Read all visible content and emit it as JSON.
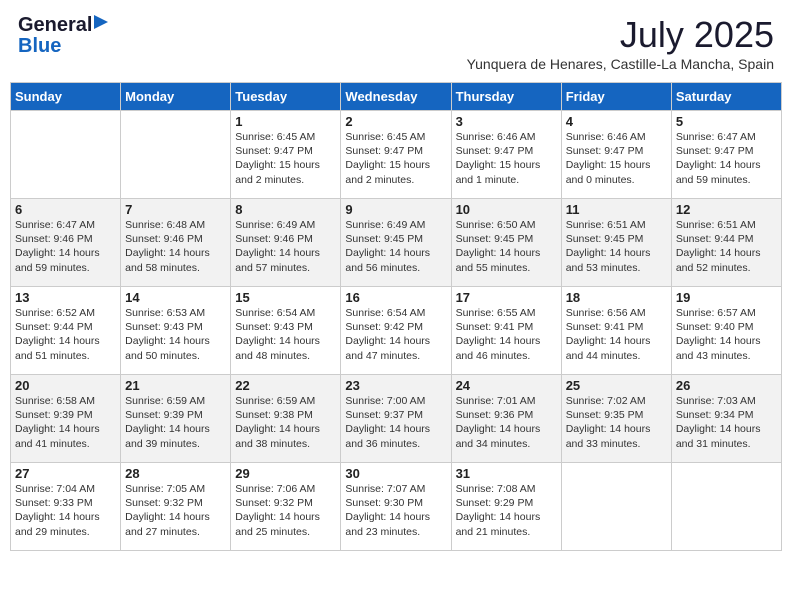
{
  "logo": {
    "general": "General",
    "blue": "Blue"
  },
  "title": {
    "month_year": "July 2025",
    "location": "Yunquera de Henares, Castille-La Mancha, Spain"
  },
  "weekdays": [
    "Sunday",
    "Monday",
    "Tuesday",
    "Wednesday",
    "Thursday",
    "Friday",
    "Saturday"
  ],
  "weeks": [
    [
      {
        "day": "",
        "sunrise": "",
        "sunset": "",
        "daylight": ""
      },
      {
        "day": "",
        "sunrise": "",
        "sunset": "",
        "daylight": ""
      },
      {
        "day": "1",
        "sunrise": "Sunrise: 6:45 AM",
        "sunset": "Sunset: 9:47 PM",
        "daylight": "Daylight: 15 hours and 2 minutes."
      },
      {
        "day": "2",
        "sunrise": "Sunrise: 6:45 AM",
        "sunset": "Sunset: 9:47 PM",
        "daylight": "Daylight: 15 hours and 2 minutes."
      },
      {
        "day": "3",
        "sunrise": "Sunrise: 6:46 AM",
        "sunset": "Sunset: 9:47 PM",
        "daylight": "Daylight: 15 hours and 1 minute."
      },
      {
        "day": "4",
        "sunrise": "Sunrise: 6:46 AM",
        "sunset": "Sunset: 9:47 PM",
        "daylight": "Daylight: 15 hours and 0 minutes."
      },
      {
        "day": "5",
        "sunrise": "Sunrise: 6:47 AM",
        "sunset": "Sunset: 9:47 PM",
        "daylight": "Daylight: 14 hours and 59 minutes."
      }
    ],
    [
      {
        "day": "6",
        "sunrise": "Sunrise: 6:47 AM",
        "sunset": "Sunset: 9:46 PM",
        "daylight": "Daylight: 14 hours and 59 minutes."
      },
      {
        "day": "7",
        "sunrise": "Sunrise: 6:48 AM",
        "sunset": "Sunset: 9:46 PM",
        "daylight": "Daylight: 14 hours and 58 minutes."
      },
      {
        "day": "8",
        "sunrise": "Sunrise: 6:49 AM",
        "sunset": "Sunset: 9:46 PM",
        "daylight": "Daylight: 14 hours and 57 minutes."
      },
      {
        "day": "9",
        "sunrise": "Sunrise: 6:49 AM",
        "sunset": "Sunset: 9:45 PM",
        "daylight": "Daylight: 14 hours and 56 minutes."
      },
      {
        "day": "10",
        "sunrise": "Sunrise: 6:50 AM",
        "sunset": "Sunset: 9:45 PM",
        "daylight": "Daylight: 14 hours and 55 minutes."
      },
      {
        "day": "11",
        "sunrise": "Sunrise: 6:51 AM",
        "sunset": "Sunset: 9:45 PM",
        "daylight": "Daylight: 14 hours and 53 minutes."
      },
      {
        "day": "12",
        "sunrise": "Sunrise: 6:51 AM",
        "sunset": "Sunset: 9:44 PM",
        "daylight": "Daylight: 14 hours and 52 minutes."
      }
    ],
    [
      {
        "day": "13",
        "sunrise": "Sunrise: 6:52 AM",
        "sunset": "Sunset: 9:44 PM",
        "daylight": "Daylight: 14 hours and 51 minutes."
      },
      {
        "day": "14",
        "sunrise": "Sunrise: 6:53 AM",
        "sunset": "Sunset: 9:43 PM",
        "daylight": "Daylight: 14 hours and 50 minutes."
      },
      {
        "day": "15",
        "sunrise": "Sunrise: 6:54 AM",
        "sunset": "Sunset: 9:43 PM",
        "daylight": "Daylight: 14 hours and 48 minutes."
      },
      {
        "day": "16",
        "sunrise": "Sunrise: 6:54 AM",
        "sunset": "Sunset: 9:42 PM",
        "daylight": "Daylight: 14 hours and 47 minutes."
      },
      {
        "day": "17",
        "sunrise": "Sunrise: 6:55 AM",
        "sunset": "Sunset: 9:41 PM",
        "daylight": "Daylight: 14 hours and 46 minutes."
      },
      {
        "day": "18",
        "sunrise": "Sunrise: 6:56 AM",
        "sunset": "Sunset: 9:41 PM",
        "daylight": "Daylight: 14 hours and 44 minutes."
      },
      {
        "day": "19",
        "sunrise": "Sunrise: 6:57 AM",
        "sunset": "Sunset: 9:40 PM",
        "daylight": "Daylight: 14 hours and 43 minutes."
      }
    ],
    [
      {
        "day": "20",
        "sunrise": "Sunrise: 6:58 AM",
        "sunset": "Sunset: 9:39 PM",
        "daylight": "Daylight: 14 hours and 41 minutes."
      },
      {
        "day": "21",
        "sunrise": "Sunrise: 6:59 AM",
        "sunset": "Sunset: 9:39 PM",
        "daylight": "Daylight: 14 hours and 39 minutes."
      },
      {
        "day": "22",
        "sunrise": "Sunrise: 6:59 AM",
        "sunset": "Sunset: 9:38 PM",
        "daylight": "Daylight: 14 hours and 38 minutes."
      },
      {
        "day": "23",
        "sunrise": "Sunrise: 7:00 AM",
        "sunset": "Sunset: 9:37 PM",
        "daylight": "Daylight: 14 hours and 36 minutes."
      },
      {
        "day": "24",
        "sunrise": "Sunrise: 7:01 AM",
        "sunset": "Sunset: 9:36 PM",
        "daylight": "Daylight: 14 hours and 34 minutes."
      },
      {
        "day": "25",
        "sunrise": "Sunrise: 7:02 AM",
        "sunset": "Sunset: 9:35 PM",
        "daylight": "Daylight: 14 hours and 33 minutes."
      },
      {
        "day": "26",
        "sunrise": "Sunrise: 7:03 AM",
        "sunset": "Sunset: 9:34 PM",
        "daylight": "Daylight: 14 hours and 31 minutes."
      }
    ],
    [
      {
        "day": "27",
        "sunrise": "Sunrise: 7:04 AM",
        "sunset": "Sunset: 9:33 PM",
        "daylight": "Daylight: 14 hours and 29 minutes."
      },
      {
        "day": "28",
        "sunrise": "Sunrise: 7:05 AM",
        "sunset": "Sunset: 9:32 PM",
        "daylight": "Daylight: 14 hours and 27 minutes."
      },
      {
        "day": "29",
        "sunrise": "Sunrise: 7:06 AM",
        "sunset": "Sunset: 9:32 PM",
        "daylight": "Daylight: 14 hours and 25 minutes."
      },
      {
        "day": "30",
        "sunrise": "Sunrise: 7:07 AM",
        "sunset": "Sunset: 9:30 PM",
        "daylight": "Daylight: 14 hours and 23 minutes."
      },
      {
        "day": "31",
        "sunrise": "Sunrise: 7:08 AM",
        "sunset": "Sunset: 9:29 PM",
        "daylight": "Daylight: 14 hours and 21 minutes."
      },
      {
        "day": "",
        "sunrise": "",
        "sunset": "",
        "daylight": ""
      },
      {
        "day": "",
        "sunrise": "",
        "sunset": "",
        "daylight": ""
      }
    ]
  ]
}
